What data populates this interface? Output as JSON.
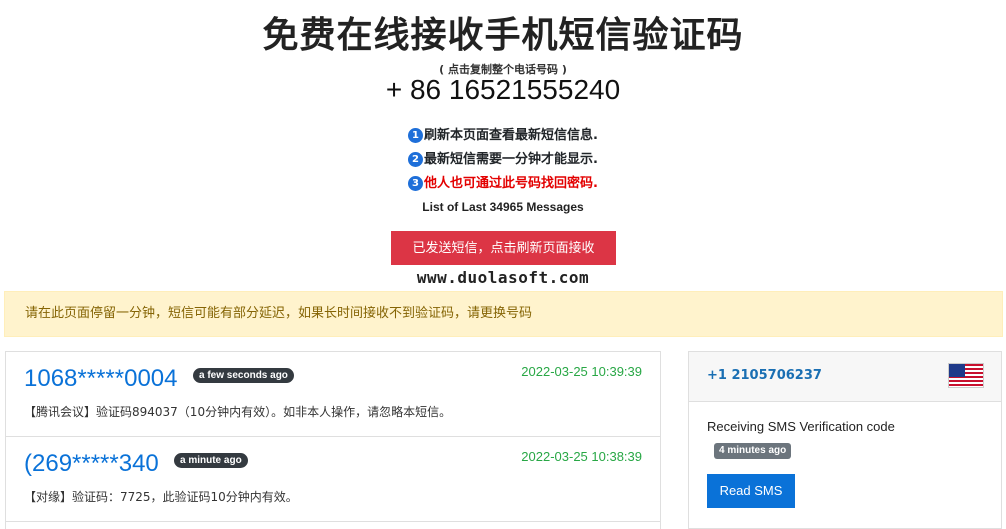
{
  "header": {
    "title": "免费在线接收手机短信验证码",
    "copy_hint": "( 点击复制整个电话号码 )",
    "phone_number": "+ 86 16521555240"
  },
  "notes": [
    {
      "num": "1",
      "text": "刷新本页面查看最新短信信息."
    },
    {
      "num": "2",
      "text": "最新短信需要一分钟才能显示."
    },
    {
      "num": "3",
      "text": "他人也可通过此号码找回密码."
    }
  ],
  "list_count": "List of Last 34965 Messages",
  "sent_button_label": "已发送短信，点击刷新页面接收",
  "site_watermark": "www.duolasoft.com",
  "alert_text": "请在此页面停留一分钟，短信可能有部分延迟，如果长时间接收不到验证码，请更换号码",
  "messages": [
    {
      "sender": "1068*****0004",
      "age": "a few seconds ago",
      "time": "2022-03-25 10:39:39",
      "body": "【腾讯会议】验证码894037（10分钟内有效）。如非本人操作，请忽略本短信。"
    },
    {
      "sender": "(269*****340",
      "age": "a minute ago",
      "time": "2022-03-25 10:38:39",
      "body": "【对缘】验证码：7725，此验证码10分钟内有效。"
    }
  ],
  "side_card": {
    "number": "+1 2105706237",
    "flag_icon": "us-flag-icon",
    "description": "Receiving SMS Verification code",
    "age": "4 minutes ago",
    "button_label": "Read SMS"
  },
  "colors": {
    "accent_blue": "#0a72d8",
    "danger_red": "#dc3545",
    "time_green": "#28a745",
    "alert_bg": "#fff3cd"
  }
}
